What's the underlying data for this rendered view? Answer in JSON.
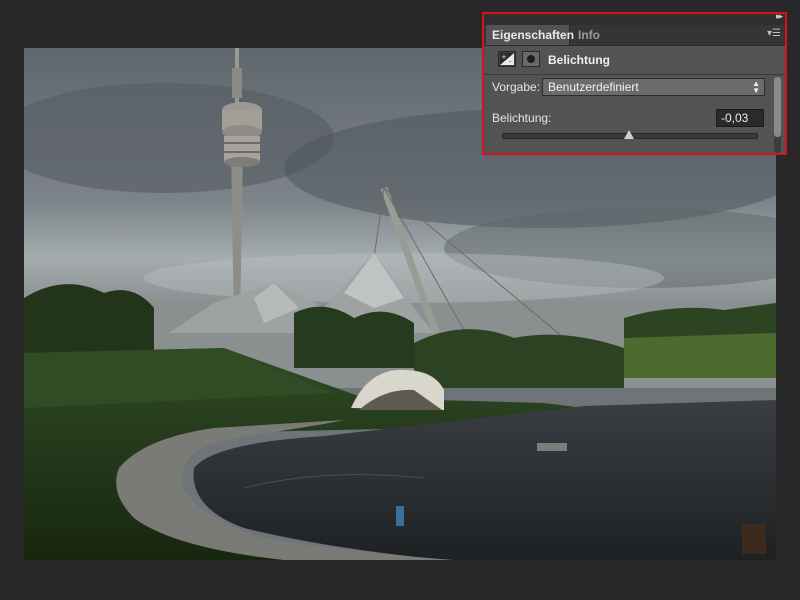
{
  "panel": {
    "tabs": [
      {
        "label": "Eigenschaften",
        "active": true
      },
      {
        "label": "Info",
        "active": false
      }
    ],
    "title": "Belichtung",
    "preset_label": "Vorgabe:",
    "preset_value": "Benutzerdefiniert",
    "exposure_label": "Belichtung:",
    "exposure_value": "-0,03",
    "slider_fraction": 0.497,
    "icons": {
      "adjustment": "exposure-adjustment-icon",
      "mask": "layer-mask-icon",
      "menu": "panel-menu-icon",
      "collapse": "collapse-panel-icon"
    },
    "highlight_color": "#d8121b"
  },
  "canvas": {
    "description_icon": "photo-canvas"
  }
}
